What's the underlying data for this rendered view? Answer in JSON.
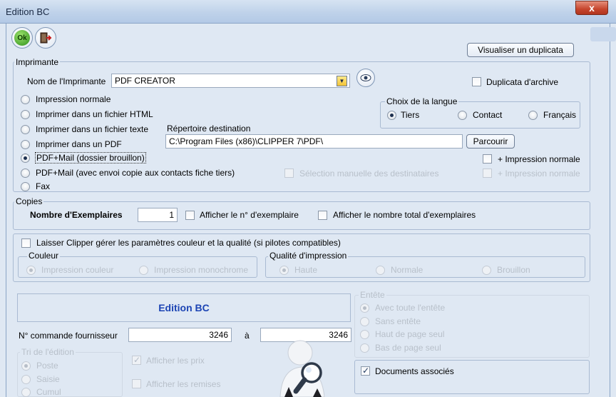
{
  "window": {
    "title": "Edition BC",
    "close_glyph": "x"
  },
  "toolbar": {
    "ok_label": "Ok",
    "ok_icon": "ok-icon",
    "exit_icon": "exit-door-icon"
  },
  "buttons": {
    "duplicate": "Visualiser un duplicata",
    "browse": "Parcourir"
  },
  "printer": {
    "group_label": "Imprimante",
    "name_label": "Nom de l'Imprimante",
    "name_value": "PDF CREATOR",
    "archive_label": "Duplicata d'archive",
    "options": [
      "Impression normale",
      "Imprimer dans un fichier HTML",
      "Imprimer dans un fichier texte",
      "Imprimer dans un PDF",
      "PDF+Mail (dossier brouillon)",
      "PDF+Mail (avec envoi copie aux contacts fiche tiers)",
      "Fax"
    ],
    "selected": "PDF+Mail (dossier brouillon)",
    "dest_label": "Répertoire destination",
    "dest_value": "C:\\Program Files (x86)\\CLIPPER 7\\PDF\\",
    "plus_normal_1": "+ Impression normale",
    "manual_sel": "Sélection manuelle des destinataires",
    "plus_normal_2": "+ Impression normale"
  },
  "language": {
    "group_label": "Choix de la langue",
    "options": [
      "Tiers",
      "Contact",
      "Français"
    ],
    "selected": "Tiers"
  },
  "copies": {
    "group_label": "Copies",
    "count_label": "Nombre d'Exemplaires",
    "count_value": "1",
    "show_number": "Afficher le n° d'exemplaire",
    "show_total": "Afficher le nombre total d'exemplaires"
  },
  "quality": {
    "let_clipper": "Laisser Clipper gérer les paramètres couleur et la qualité (si pilotes compatibles)",
    "color_group": "Couleur",
    "color_options": [
      "Impression couleur",
      "Impression monochrome"
    ],
    "quality_group": "Qualité d'impression",
    "quality_options": [
      "Haute",
      "Normale",
      "Brouillon"
    ]
  },
  "edition": {
    "title": "Edition BC",
    "order_label": "N° commande fournisseur",
    "from_value": "3246",
    "to_label": "à",
    "to_value": "3246",
    "sort_group": "Tri de l'édition",
    "sort_options": [
      "Poste",
      "Saisie",
      "Cumul"
    ],
    "show_prices": "Afficher les prix",
    "show_discounts": "Afficher les remises"
  },
  "header": {
    "group_label": "Entête",
    "options": [
      "Avec toute l'entête",
      "Sans entête",
      "Haut de page seul",
      "Bas de page seul"
    ],
    "docs_label": "Documents associés"
  }
}
